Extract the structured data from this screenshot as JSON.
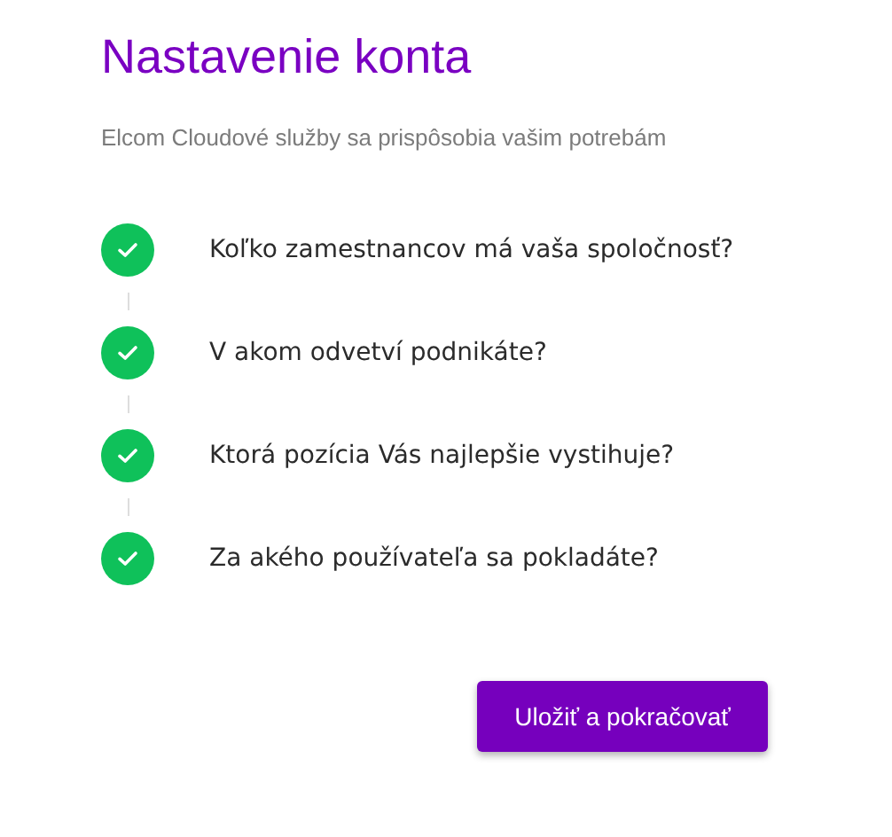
{
  "title": "Nastavenie konta",
  "subtitle": "Elcom Cloudové služby sa prispôsobia vašim potrebám",
  "steps": [
    {
      "label": "Koľko zamestnancov má vaša spoločnosť?",
      "done": true
    },
    {
      "label": "V akom odvetví podnikáte?",
      "done": true
    },
    {
      "label": "Ktorá pozícia Vás najlepšie vystihuje?",
      "done": true
    },
    {
      "label": "Za akého používateľa sa pokladáte?",
      "done": true
    }
  ],
  "button": "Uložiť a pokračovať"
}
